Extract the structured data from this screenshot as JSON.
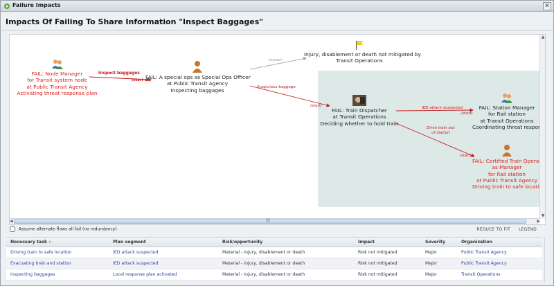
{
  "window": {
    "title": "Failure Impacts",
    "close_glyph": "✕"
  },
  "heading": "Impacts Of Failing To Share Information \"Inspect Baggages\"",
  "diagram": {
    "nodes": {
      "node_manager": "FAIL: Node Manager\nfor Transit system node\nat Public Transit Agency\nActivating threat response plan",
      "special_ops": "FAIL: A special ops as Special Ops Officer\nat Public Transit Agency\nInspecting baggages",
      "injury": "Injury, disablement or death not mitigated by\nTransit Operations",
      "train_dispatcher": "FAIL: Train Dispatcher\nat Transit Operations\nDeciding whether to hold train",
      "station_manager": "FAIL: Station Manager\nfor Rail station\nat Transit Operations\nCoordinating threat response",
      "train_operator": "FAIL: Certified Train Operator\nas Manager\nfor Rail station\nat Public Transit Agency\nDriving train to safe location"
    },
    "edges": {
      "inspect_baggages": "Inspect baggages",
      "start_all": "(start all)",
      "impact": "impact",
      "suspicious_baggage": "Suspicious baggage",
      "ied_attack": "IED attack suspected",
      "drive_train_out": "Drive train out\nof station",
      "start": "(start)"
    },
    "colors": {
      "fail": "#d92020",
      "edge": "#c21a1a",
      "impact_edge": "#9a9a9a",
      "region": "#dde9e7"
    }
  },
  "options": {
    "redundancy_label": "Assume alternate flows all fail (no redundancy)",
    "checked": false
  },
  "tools": {
    "reduce": "REDUCE TO FIT",
    "legend": "LEGEND"
  },
  "table": {
    "headers": [
      "Necessary task",
      "Plan segment",
      "Risk/opportunity",
      "Impact",
      "Severity",
      "Organization"
    ],
    "rows": [
      [
        "Driving train to safe location",
        "IED attack suspected",
        "Material - Injury, disablement or death",
        "Risk not mitigated",
        "Major",
        "Public Transit Agency"
      ],
      [
        "Evacuating train and station",
        "IED attack suspected",
        "Material - Injury, disablement or death",
        "Risk not mitigated",
        "Major",
        "Public Transit Agency"
      ],
      [
        "Inspecting baggages",
        "Local response plan activated",
        "Material - Injury, disablement or death",
        "Risk not mitigated",
        "Major",
        "Transit Operations"
      ]
    ]
  }
}
